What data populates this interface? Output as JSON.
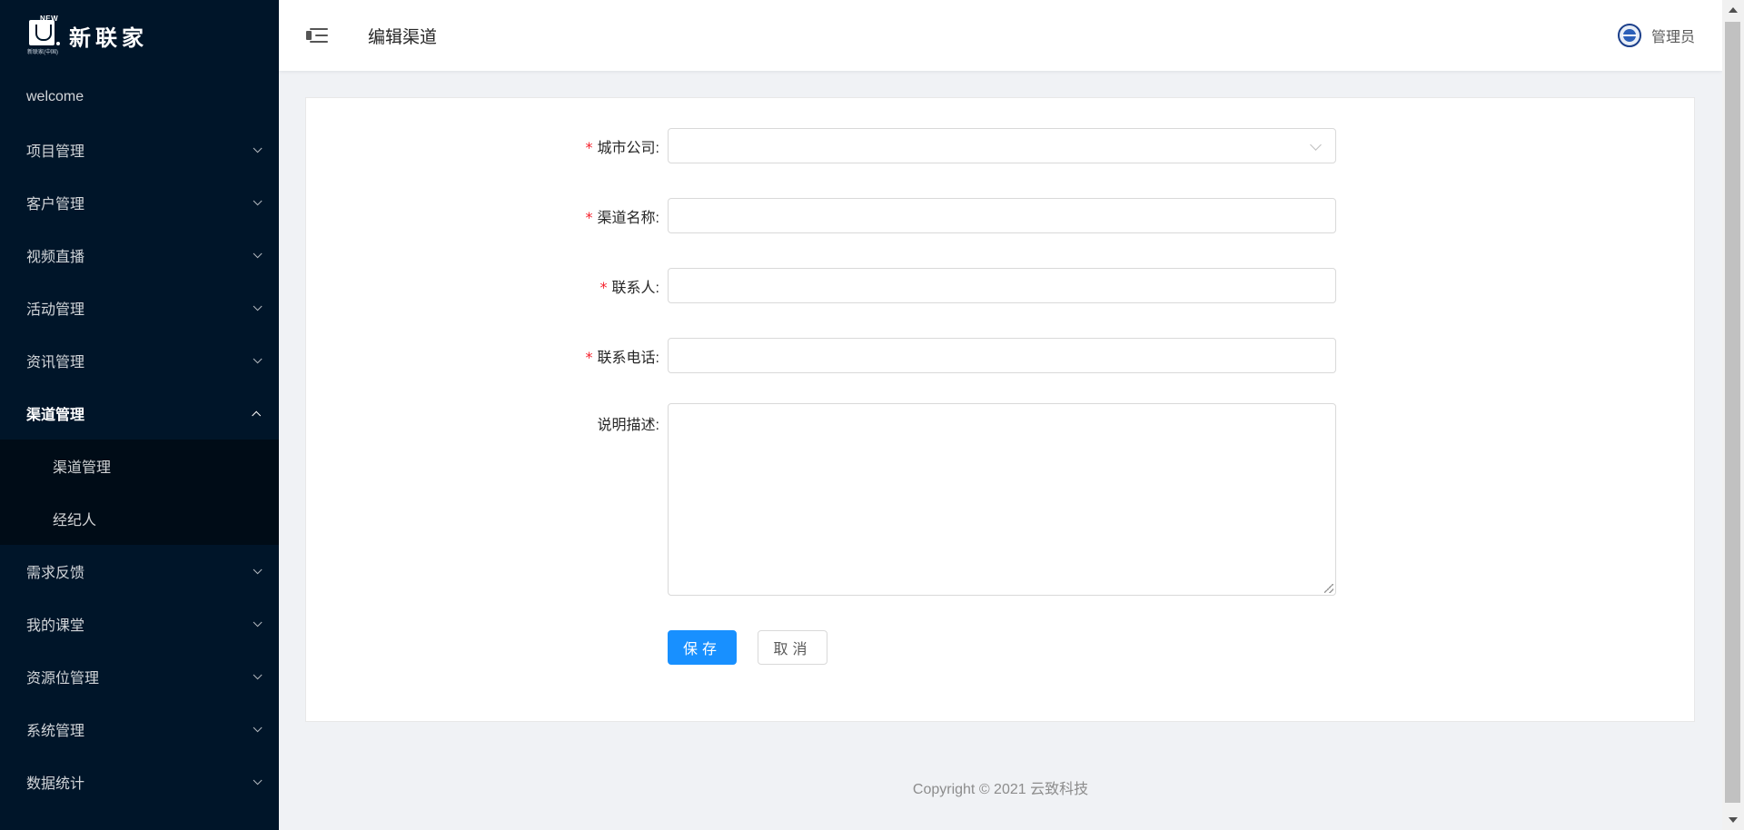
{
  "brand": {
    "logo_new": "NEW",
    "logo_sub": "新联家(中国)",
    "name": "新联家"
  },
  "sidebar": {
    "items": [
      {
        "label": "welcome"
      },
      {
        "label": "项目管理"
      },
      {
        "label": "客户管理"
      },
      {
        "label": "视频直播"
      },
      {
        "label": "活动管理"
      },
      {
        "label": "资讯管理"
      },
      {
        "label": "渠道管理"
      },
      {
        "label": "需求反馈"
      },
      {
        "label": "我的课堂"
      },
      {
        "label": "资源位管理"
      },
      {
        "label": "系统管理"
      },
      {
        "label": "数据统计"
      }
    ],
    "submenu": [
      {
        "label": "渠道管理"
      },
      {
        "label": "经纪人"
      }
    ]
  },
  "header": {
    "title": "编辑渠道",
    "user": "管理员"
  },
  "form": {
    "required_mark": "*",
    "city_company": {
      "label": "城市公司:",
      "value": ""
    },
    "channel_name": {
      "label": "渠道名称:",
      "value": ""
    },
    "contact": {
      "label": "联系人:",
      "value": ""
    },
    "phone": {
      "label": "联系电话:",
      "value": ""
    },
    "description": {
      "label": "说明描述:",
      "value": ""
    },
    "save_label": "保存",
    "cancel_label": "取消"
  },
  "footer": {
    "copyright": "Copyright © 2021 云致科技"
  },
  "colors": {
    "sider_bg": "#001529",
    "primary": "#1890ff",
    "required": "#f5222d"
  }
}
